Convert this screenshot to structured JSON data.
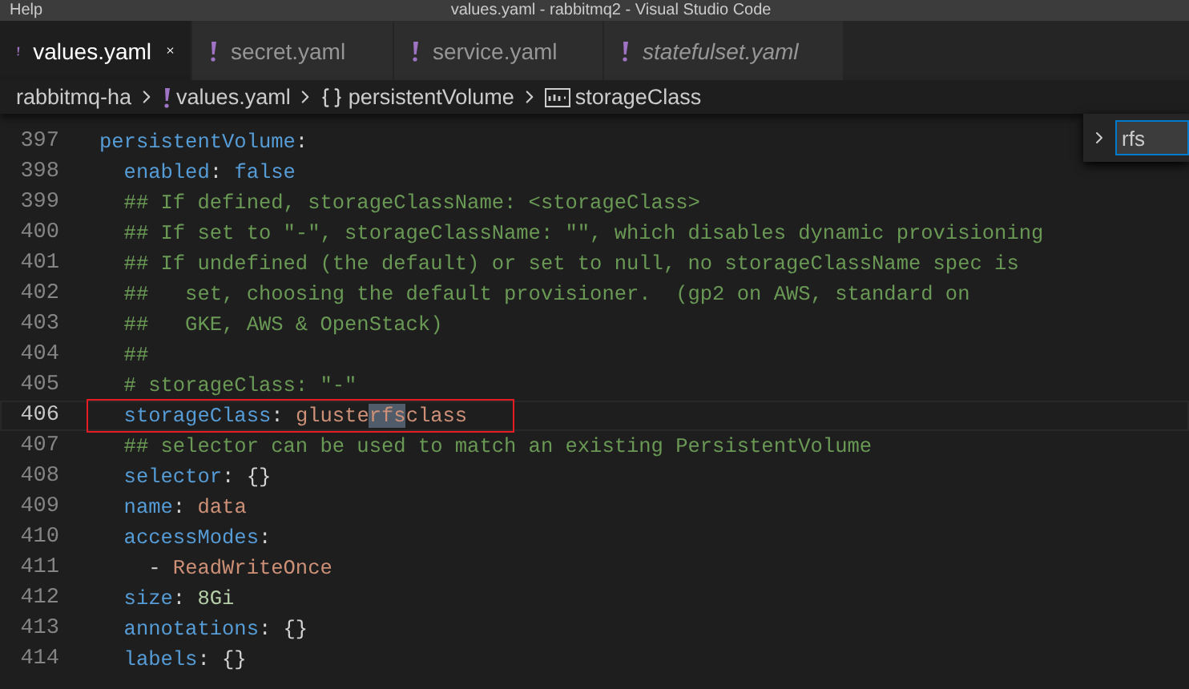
{
  "title_bar": {
    "menu": "Help",
    "title": "values.yaml - rabbitmq2 - Visual Studio Code"
  },
  "tabs": [
    {
      "label": "values.yaml",
      "selected": true,
      "preview": false
    },
    {
      "label": "secret.yaml",
      "selected": false,
      "preview": false
    },
    {
      "label": "service.yaml",
      "selected": false,
      "preview": false
    },
    {
      "label": "statefulset.yaml",
      "selected": false,
      "preview": true
    }
  ],
  "breadcrumb": [
    {
      "label": "rabbitmq-ha",
      "kind": "folder"
    },
    {
      "label": "values.yaml",
      "kind": "file"
    },
    {
      "label": "persistentVolume",
      "kind": "object"
    },
    {
      "label": "storageClass",
      "kind": "string"
    }
  ],
  "find_widget": {
    "value": "rfs"
  },
  "lines": [
    {
      "number": "397",
      "highlighted": false,
      "segments": [
        {
          "text": "persistentVolume",
          "kind": "key"
        },
        {
          "text": ":",
          "kind": "punct"
        }
      ]
    },
    {
      "number": "398",
      "highlighted": false,
      "segments": [
        {
          "text": "  enabled",
          "kind": "key"
        },
        {
          "text": ": ",
          "kind": "punct"
        },
        {
          "text": "false",
          "kind": "bool"
        }
      ]
    },
    {
      "number": "399",
      "highlighted": false,
      "segments": [
        {
          "text": "  ## If defined, storageClassName: <storageClass>",
          "kind": "comment"
        }
      ]
    },
    {
      "number": "400",
      "highlighted": false,
      "segments": [
        {
          "text": "  ## If set to \"-\", storageClassName: \"\", which disables dynamic provisioning",
          "kind": "comment"
        }
      ]
    },
    {
      "number": "401",
      "highlighted": false,
      "segments": [
        {
          "text": "  ## If undefined (the default) or set to null, no storageClassName spec is",
          "kind": "comment"
        }
      ]
    },
    {
      "number": "402",
      "highlighted": false,
      "segments": [
        {
          "text": "  ##   set, choosing the default provisioner.  (gp2 on AWS, standard on",
          "kind": "comment"
        }
      ]
    },
    {
      "number": "403",
      "highlighted": false,
      "segments": [
        {
          "text": "  ##   GKE, AWS & OpenStack)",
          "kind": "comment"
        }
      ]
    },
    {
      "number": "404",
      "highlighted": false,
      "segments": [
        {
          "text": "  ##",
          "kind": "comment"
        }
      ]
    },
    {
      "number": "405",
      "highlighted": false,
      "segments": [
        {
          "text": "  # storageClass: \"-\"",
          "kind": "comment"
        }
      ]
    },
    {
      "number": "406",
      "highlighted": true,
      "segments": [
        {
          "text": "  storageClass",
          "kind": "key"
        },
        {
          "text": ": ",
          "kind": "punct"
        },
        {
          "text": "gluste",
          "kind": "string"
        },
        {
          "text": "rfs",
          "kind": "match"
        },
        {
          "text": "class",
          "kind": "string"
        }
      ]
    },
    {
      "number": "407",
      "highlighted": false,
      "segments": [
        {
          "text": "  ## selector can be used to match an existing PersistentVolume",
          "kind": "comment"
        }
      ]
    },
    {
      "number": "408",
      "highlighted": false,
      "segments": [
        {
          "text": "  selector",
          "kind": "key"
        },
        {
          "text": ": {}",
          "kind": "punct"
        }
      ]
    },
    {
      "number": "409",
      "highlighted": false,
      "segments": [
        {
          "text": "  name",
          "kind": "key"
        },
        {
          "text": ": ",
          "kind": "punct"
        },
        {
          "text": "data",
          "kind": "string"
        }
      ]
    },
    {
      "number": "410",
      "highlighted": false,
      "segments": [
        {
          "text": "  accessModes",
          "kind": "key"
        },
        {
          "text": ":",
          "kind": "punct"
        }
      ]
    },
    {
      "number": "411",
      "highlighted": false,
      "segments": [
        {
          "text": "    - ",
          "kind": "punct"
        },
        {
          "text": "ReadWriteOnce",
          "kind": "string"
        }
      ]
    },
    {
      "number": "412",
      "highlighted": false,
      "segments": [
        {
          "text": "  size",
          "kind": "key"
        },
        {
          "text": ": ",
          "kind": "punct"
        },
        {
          "text": "8Gi",
          "kind": "number"
        }
      ]
    },
    {
      "number": "413",
      "highlighted": false,
      "segments": [
        {
          "text": "  annotations",
          "kind": "key"
        },
        {
          "text": ": {}",
          "kind": "punct"
        }
      ]
    },
    {
      "number": "414",
      "highlighted": false,
      "segments": [
        {
          "text": "  labels",
          "kind": "key"
        },
        {
          "text": ": {}",
          "kind": "punct"
        }
      ]
    }
  ]
}
